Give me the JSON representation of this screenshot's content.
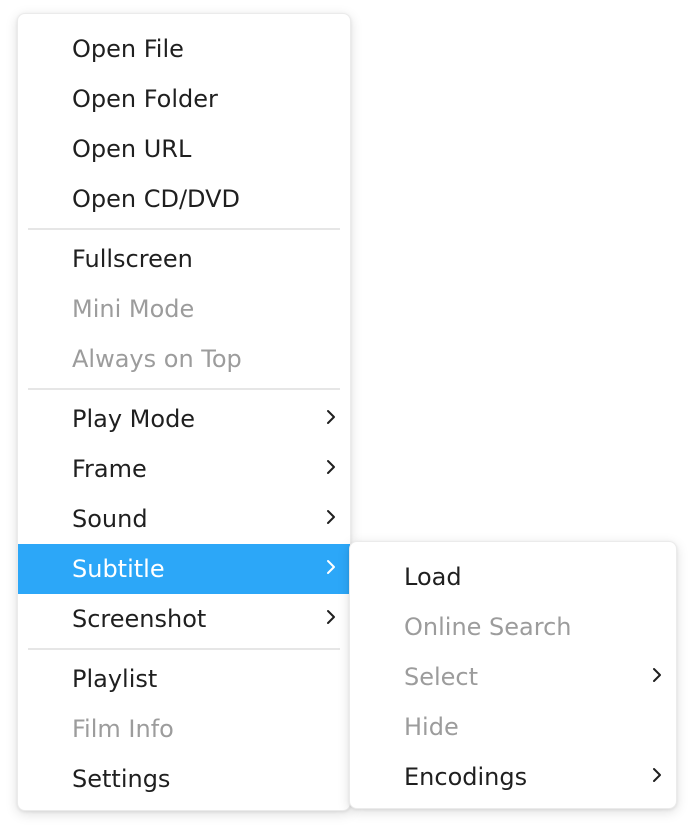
{
  "main_menu": {
    "groups": [
      {
        "items": [
          {
            "label": "Open File",
            "state": "enabled",
            "submenu": false
          },
          {
            "label": "Open Folder",
            "state": "enabled",
            "submenu": false
          },
          {
            "label": "Open URL",
            "state": "enabled",
            "submenu": false
          },
          {
            "label": "Open CD/DVD",
            "state": "enabled",
            "submenu": false
          }
        ]
      },
      {
        "items": [
          {
            "label": "Fullscreen",
            "state": "enabled",
            "submenu": false
          },
          {
            "label": "Mini Mode",
            "state": "disabled",
            "submenu": false
          },
          {
            "label": "Always on Top",
            "state": "disabled",
            "submenu": false
          }
        ]
      },
      {
        "items": [
          {
            "label": "Play Mode",
            "state": "enabled",
            "submenu": true
          },
          {
            "label": "Frame",
            "state": "enabled",
            "submenu": true
          },
          {
            "label": "Sound",
            "state": "enabled",
            "submenu": true
          },
          {
            "label": "Subtitle",
            "state": "active",
            "submenu": true
          },
          {
            "label": "Screenshot",
            "state": "enabled",
            "submenu": true
          }
        ]
      },
      {
        "items": [
          {
            "label": "Playlist",
            "state": "enabled",
            "submenu": false
          },
          {
            "label": "Film Info",
            "state": "disabled",
            "submenu": false
          },
          {
            "label": "Settings",
            "state": "enabled",
            "submenu": false
          }
        ]
      }
    ]
  },
  "subtitle_submenu": {
    "items": [
      {
        "label": "Load",
        "state": "enabled",
        "submenu": false
      },
      {
        "label": "Online Search",
        "state": "disabled",
        "submenu": false
      },
      {
        "label": "Select",
        "state": "disabled",
        "submenu": true
      },
      {
        "label": "Hide",
        "state": "disabled",
        "submenu": false
      },
      {
        "label": "Encodings",
        "state": "enabled",
        "submenu": true
      }
    ]
  },
  "colors": {
    "highlight": "#2ca7f8",
    "text": "#1f1f1f",
    "disabled_text": "#9c9c9c",
    "separator": "#e6e6e6"
  },
  "icons": {
    "submenu_indicator": "chevron-right-icon"
  }
}
